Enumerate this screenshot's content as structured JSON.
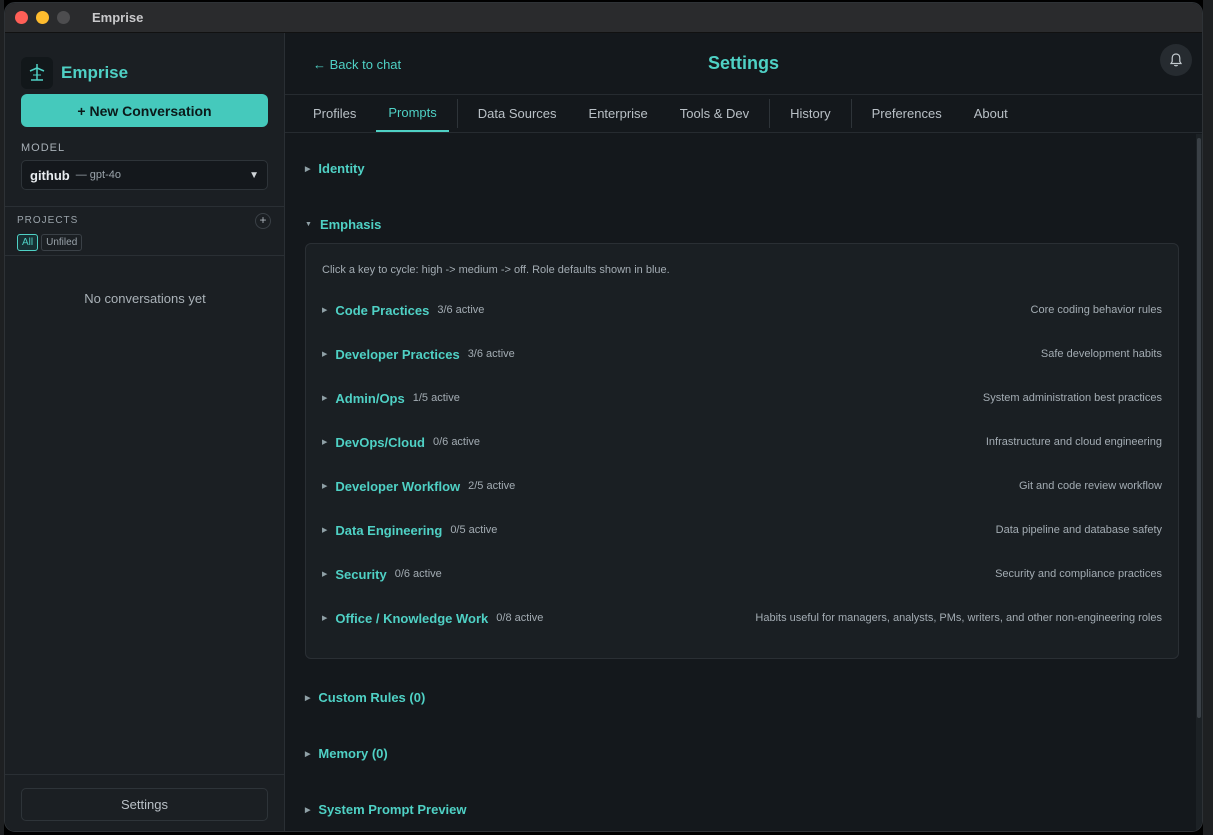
{
  "window": {
    "title": "Emprise"
  },
  "sidebar": {
    "brand": "Emprise",
    "new_conversation": "+ New Conversation",
    "model_label": "MODEL",
    "model_provider": "github",
    "model_name": "— gpt-4o",
    "projects_label": "PROJECTS",
    "filters": [
      "All",
      "Unfiled"
    ],
    "empty_text": "No conversations yet",
    "settings_label": "Settings"
  },
  "header": {
    "back_label": "← Back to chat",
    "title": "Settings"
  },
  "tabs": [
    "Profiles",
    "Prompts",
    "Data Sources",
    "Enterprise",
    "Tools & Dev",
    "History",
    "Preferences",
    "About"
  ],
  "active_tab": "Prompts",
  "sections": {
    "identity": "Identity",
    "emphasis": "Emphasis",
    "custom_rules": "Custom Rules (0)",
    "memory": "Memory (0)",
    "preview": "System Prompt Preview"
  },
  "emphasis": {
    "hint": "Click a key to cycle: high -> medium -> off. Role defaults shown in blue.",
    "categories": [
      {
        "name": "Code Practices",
        "count": "3/6 active",
        "desc": "Core coding behavior rules"
      },
      {
        "name": "Developer Practices",
        "count": "3/6 active",
        "desc": "Safe development habits"
      },
      {
        "name": "Admin/Ops",
        "count": "1/5 active",
        "desc": "System administration best practices"
      },
      {
        "name": "DevOps/Cloud",
        "count": "0/6 active",
        "desc": "Infrastructure and cloud engineering"
      },
      {
        "name": "Developer Workflow",
        "count": "2/5 active",
        "desc": "Git and code review workflow"
      },
      {
        "name": "Data Engineering",
        "count": "0/5 active",
        "desc": "Data pipeline and database safety"
      },
      {
        "name": "Security",
        "count": "0/6 active",
        "desc": "Security and compliance practices"
      },
      {
        "name": "Office / Knowledge Work",
        "count": "0/8 active",
        "desc": "Habits useful for managers, analysts, PMs, writers, and other non-engineering roles"
      }
    ]
  },
  "colors": {
    "accent": "#4fd1c5",
    "background": "#14181c",
    "sidebar": "#1b1f23"
  }
}
